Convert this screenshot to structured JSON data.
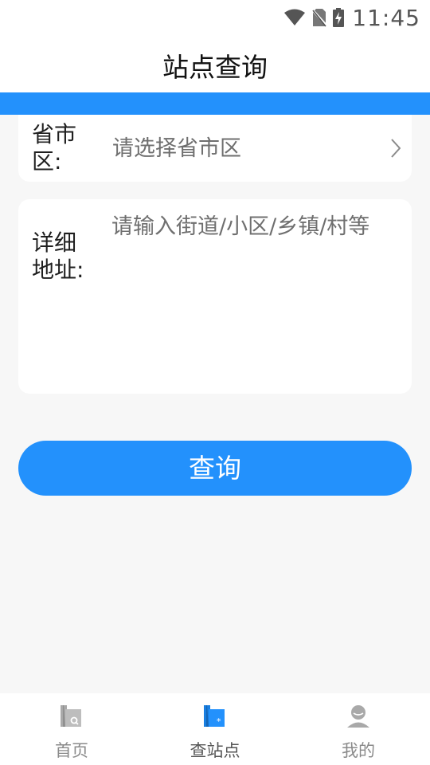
{
  "status_bar": {
    "time": "11:45",
    "icons": [
      "wifi-icon",
      "no-sim-icon",
      "battery-charging-icon"
    ]
  },
  "header": {
    "title": "站点查询"
  },
  "colors": {
    "accent": "#2391fc",
    "background": "#f7f7f7",
    "card": "#ffffff",
    "placeholder": "#6f6f6f"
  },
  "form": {
    "region": {
      "label": "省市区:",
      "placeholder": "请选择省市区",
      "icon": "chevron-right-icon"
    },
    "address": {
      "label": "详细地址:",
      "placeholder": "请输入街道/小区/乡镇/村等"
    },
    "submit_label": "查询"
  },
  "tab_bar": {
    "items": [
      {
        "label": "首页",
        "icon": "home-search-icon",
        "active": false
      },
      {
        "label": "查站点",
        "icon": "station-search-icon",
        "active": true
      },
      {
        "label": "我的",
        "icon": "user-icon",
        "active": false
      }
    ]
  }
}
